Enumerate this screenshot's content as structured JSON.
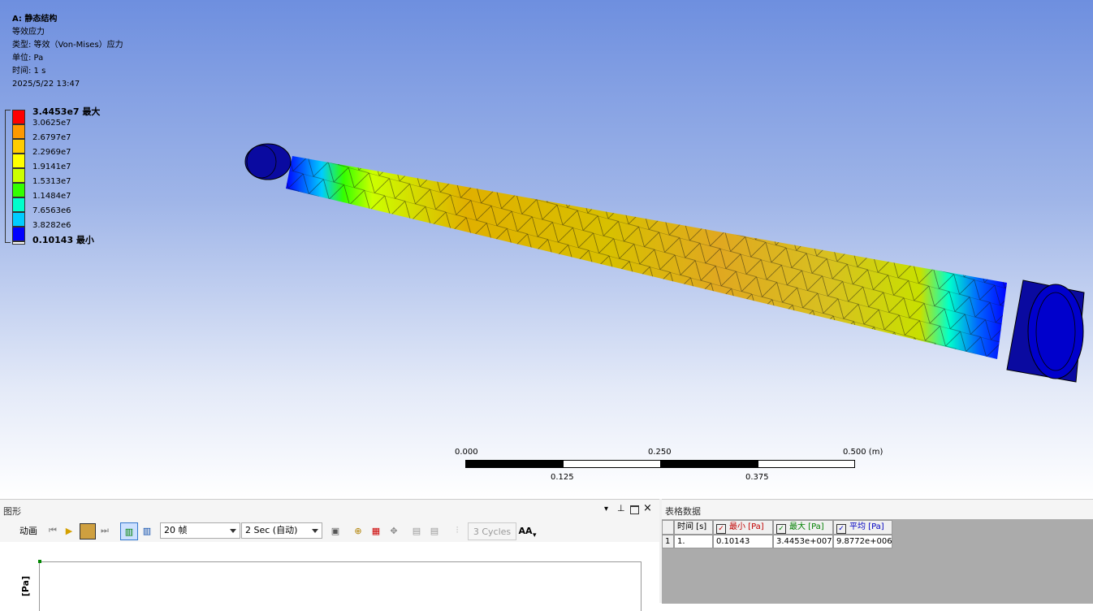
{
  "info": {
    "analysis": "A: 静态结构",
    "result": "等效应力",
    "type": "类型: 等效（Von-Mises）应力",
    "unit": "单位: Pa",
    "time": "时间: 1 s",
    "date": "2025/5/22 13:47"
  },
  "legend": {
    "entries": [
      {
        "label": "3.4453e7 最大",
        "color": "#ff0000"
      },
      {
        "label": "3.0625e7",
        "color": "#ff9900"
      },
      {
        "label": "2.6797e7",
        "color": "#ffcc00"
      },
      {
        "label": "2.2969e7",
        "color": "#ffff00"
      },
      {
        "label": "1.9141e7",
        "color": "#ccff00"
      },
      {
        "label": "1.5313e7",
        "color": "#33ff00"
      },
      {
        "label": "1.1484e7",
        "color": "#00ffcc"
      },
      {
        "label": "7.6563e6",
        "color": "#00ccff"
      },
      {
        "label": "3.8282e6",
        "color": "#0066ff"
      },
      {
        "label": "0.10143 最小",
        "color": "#0000ff"
      }
    ]
  },
  "scale": {
    "top_labels": [
      "0.000",
      "0.250",
      "0.500 (m)"
    ],
    "bottom_labels": [
      "0.125",
      "0.375"
    ]
  },
  "graph_panel": {
    "title": "图形",
    "animation_label": "动画",
    "frames": "20 帧",
    "duration": "2 Sec (自动)",
    "cycles": "3 Cycles",
    "aa": "AA",
    "y_axis_label": "[Pa]"
  },
  "table_panel": {
    "title": "表格数据",
    "headers": [
      "时间 [s]",
      "最小 [Pa]",
      "最大 [Pa]",
      "平均 [Pa]"
    ],
    "header_colors": [
      "#000000",
      "#c00000",
      "#008000",
      "#0000c0"
    ],
    "rows": [
      {
        "index": "1",
        "time": "1.",
        "min": "0.10143",
        "max": "3.4453e+007",
        "avg": "9.8772e+006"
      }
    ]
  }
}
